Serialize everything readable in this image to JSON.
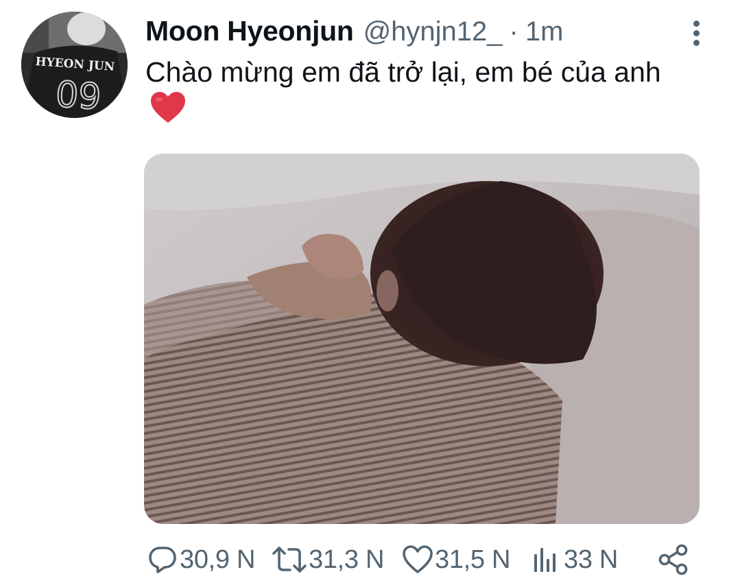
{
  "tweet": {
    "author": {
      "display_name": "Moon Hyeonjun",
      "handle": "@hynjn12_",
      "avatar_text_top": "HYEON JUN",
      "avatar_text_number": "09"
    },
    "separator": "·",
    "time": "1m",
    "text": "Chào mừng em đã trở lại, em bé của anh",
    "emoji": "red-heart",
    "media_alt": "photo"
  },
  "actions": {
    "reply": {
      "icon": "reply-icon",
      "count": "30,9 N"
    },
    "retweet": {
      "icon": "retweet-icon",
      "count": "31,3 N"
    },
    "like": {
      "icon": "heart-outline-icon",
      "count": "31,5 N"
    },
    "views": {
      "icon": "views-icon",
      "count": "33 N"
    },
    "share": {
      "icon": "share-icon"
    }
  },
  "colors": {
    "primary_text": "#0f1419",
    "secondary_text": "#536471",
    "heart": "#e0374a"
  }
}
